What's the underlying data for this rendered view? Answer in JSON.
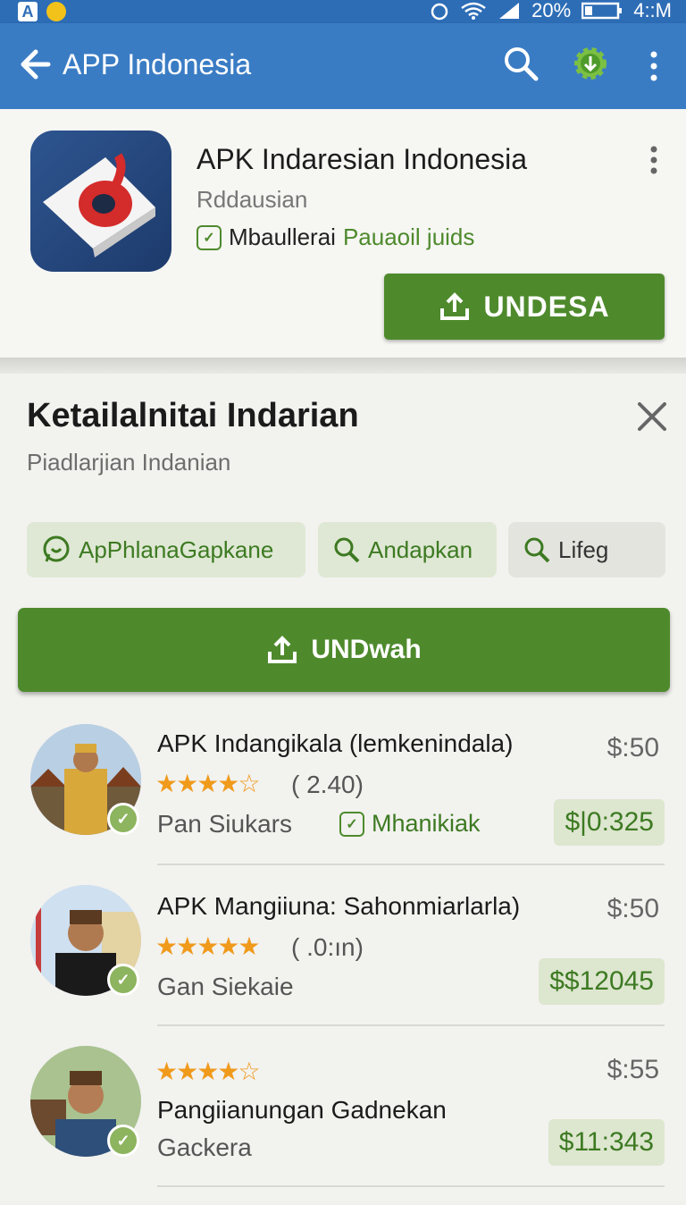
{
  "status_bar": {
    "time": "4::M",
    "battery": "20%",
    "left_icon_a": "A"
  },
  "app_bar": {
    "title": "APP Indonesia"
  },
  "app_header": {
    "name": "APK Indaresian Indonesia",
    "developer": "Rddausian",
    "badge_bold": "Mbaullerai",
    "badge_green": "Pauaoil juids",
    "install_label": "UNDESA"
  },
  "section": {
    "title": "Ketailalnitai Indarian",
    "subtitle": "Piadlarjian Indanian",
    "chips": [
      "ApPhlanaGapkane",
      "Andapkan",
      "Lifeg"
    ],
    "download_label": "UNDwah"
  },
  "items": [
    {
      "title": "APK Indangikala (lemkenindala)",
      "rating": "( 2.40)",
      "stars": 4.5,
      "subtitle": "Pan Siukars",
      "tag": "Mhanikiak",
      "price_small": "$:50",
      "price_box": "$|0:325"
    },
    {
      "title": "APK Mangiiuna: Sahonmiarlarla)",
      "rating": "( .0:ın)",
      "stars": 4.5,
      "subtitle": "Gan Siekaie",
      "tag": "",
      "price_small": "$:50",
      "price_box": "$$12045"
    },
    {
      "title": "Pangiianungan Gadnekan",
      "rating": "",
      "stars": 4,
      "subtitle": "Gackera",
      "tag": "",
      "price_small": "$:55",
      "price_box": "$11:343"
    }
  ],
  "colors": {
    "app_bar": "#3a7cc4",
    "accent_green": "#4e8a2c",
    "star": "#f09a1c"
  }
}
